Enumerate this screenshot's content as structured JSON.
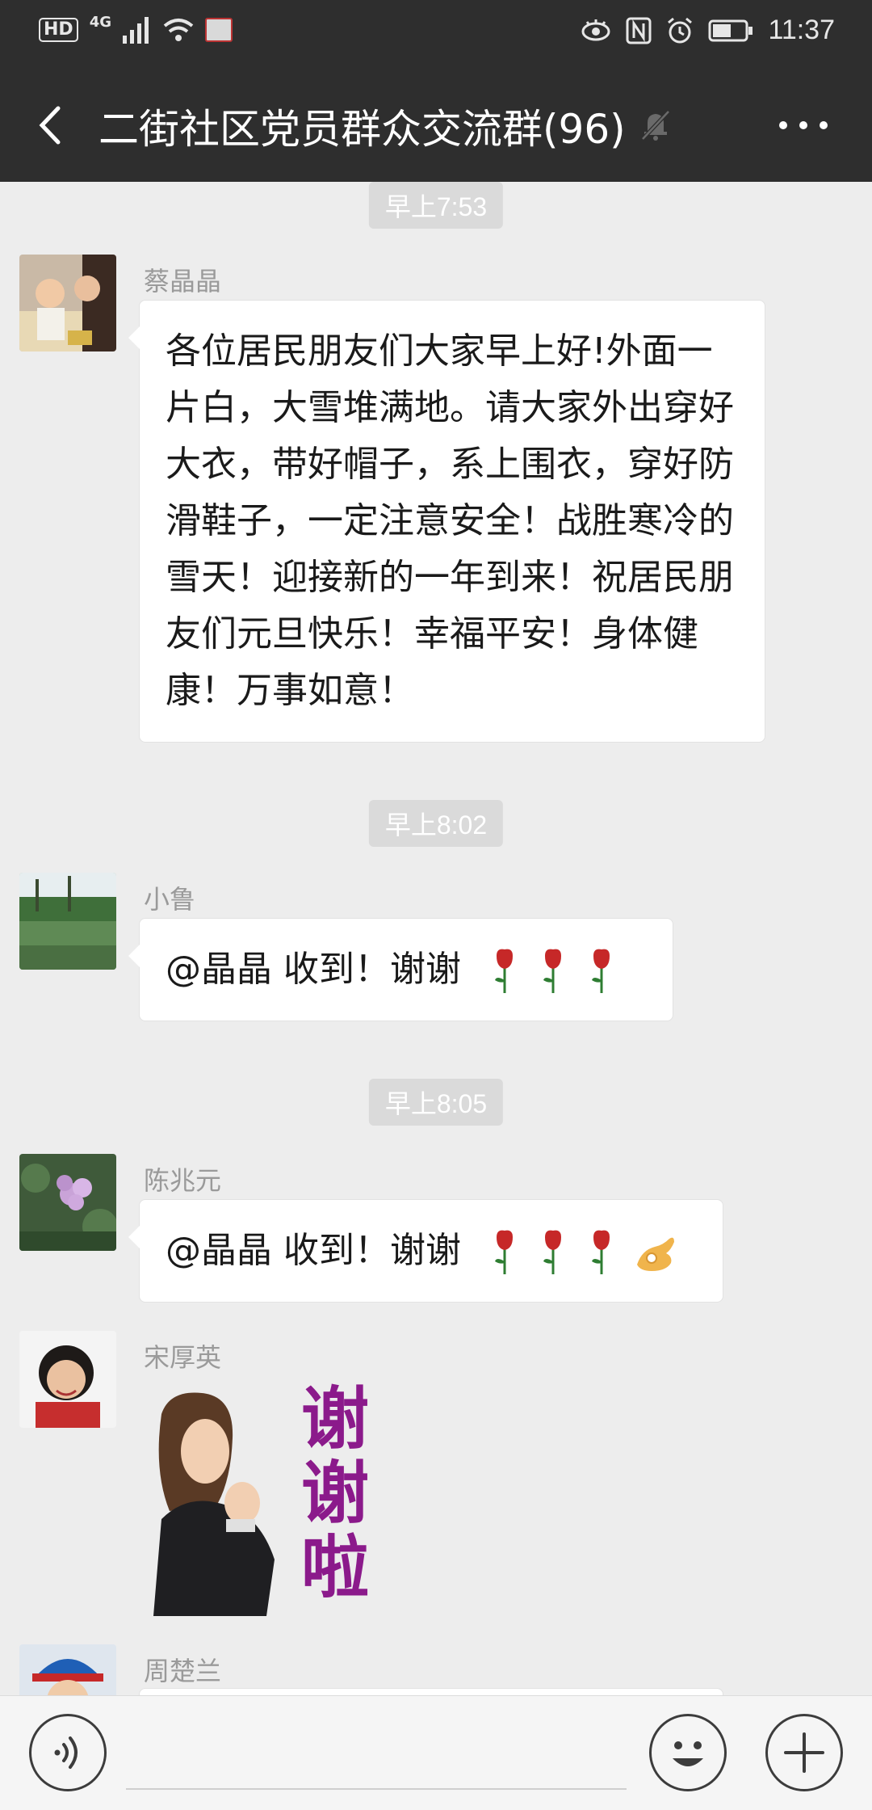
{
  "status_bar": {
    "hd": "HD",
    "network": "4G",
    "time": "11:37",
    "icons": [
      "hd-icon",
      "signal-icon",
      "wifi-icon",
      "app-notification-icon",
      "eye-icon",
      "nfc-icon",
      "alarm-icon",
      "battery-icon"
    ]
  },
  "header": {
    "title": "二街社区党员群众交流群(96)",
    "back_icon": "chevron-left-icon",
    "mute_icon": "bell-muted-icon",
    "more_icon": "more-dots-icon"
  },
  "messages": [
    {
      "time": "早上7:53",
      "sender": "蔡晶晶",
      "text": "各位居民朋友们大家早上好!外面一片白，大雪堆满地。请大家外出穿好大衣，带好帽子，系上围衣，穿好防滑鞋子，一定注意安全！战胜寒冷的雪天！迎接新的一年到来！祝居民朋友们元旦快乐！幸福平安！身体健康！万事如意！"
    },
    {
      "time": "早上8:02",
      "sender": "小鲁",
      "text": "@晶晶   收到！谢谢"
    },
    {
      "time": "早上8:05",
      "sender": "陈兆元",
      "text": "@晶晶   收到！谢谢"
    },
    {
      "sender": "宋厚英",
      "sticker_text": [
        "谢",
        "谢",
        "啦"
      ]
    },
    {
      "sender": "周楚兰"
    }
  ],
  "input_bar": {
    "voice_icon": "voice-icon",
    "emoji_icon": "emoji-icon",
    "plus_icon": "plus-icon"
  },
  "colors": {
    "header_bg": "#2e2e2e",
    "chat_bg": "#ededed",
    "bubble_bg": "#ffffff",
    "sticker_text": "#8b1a8b"
  }
}
